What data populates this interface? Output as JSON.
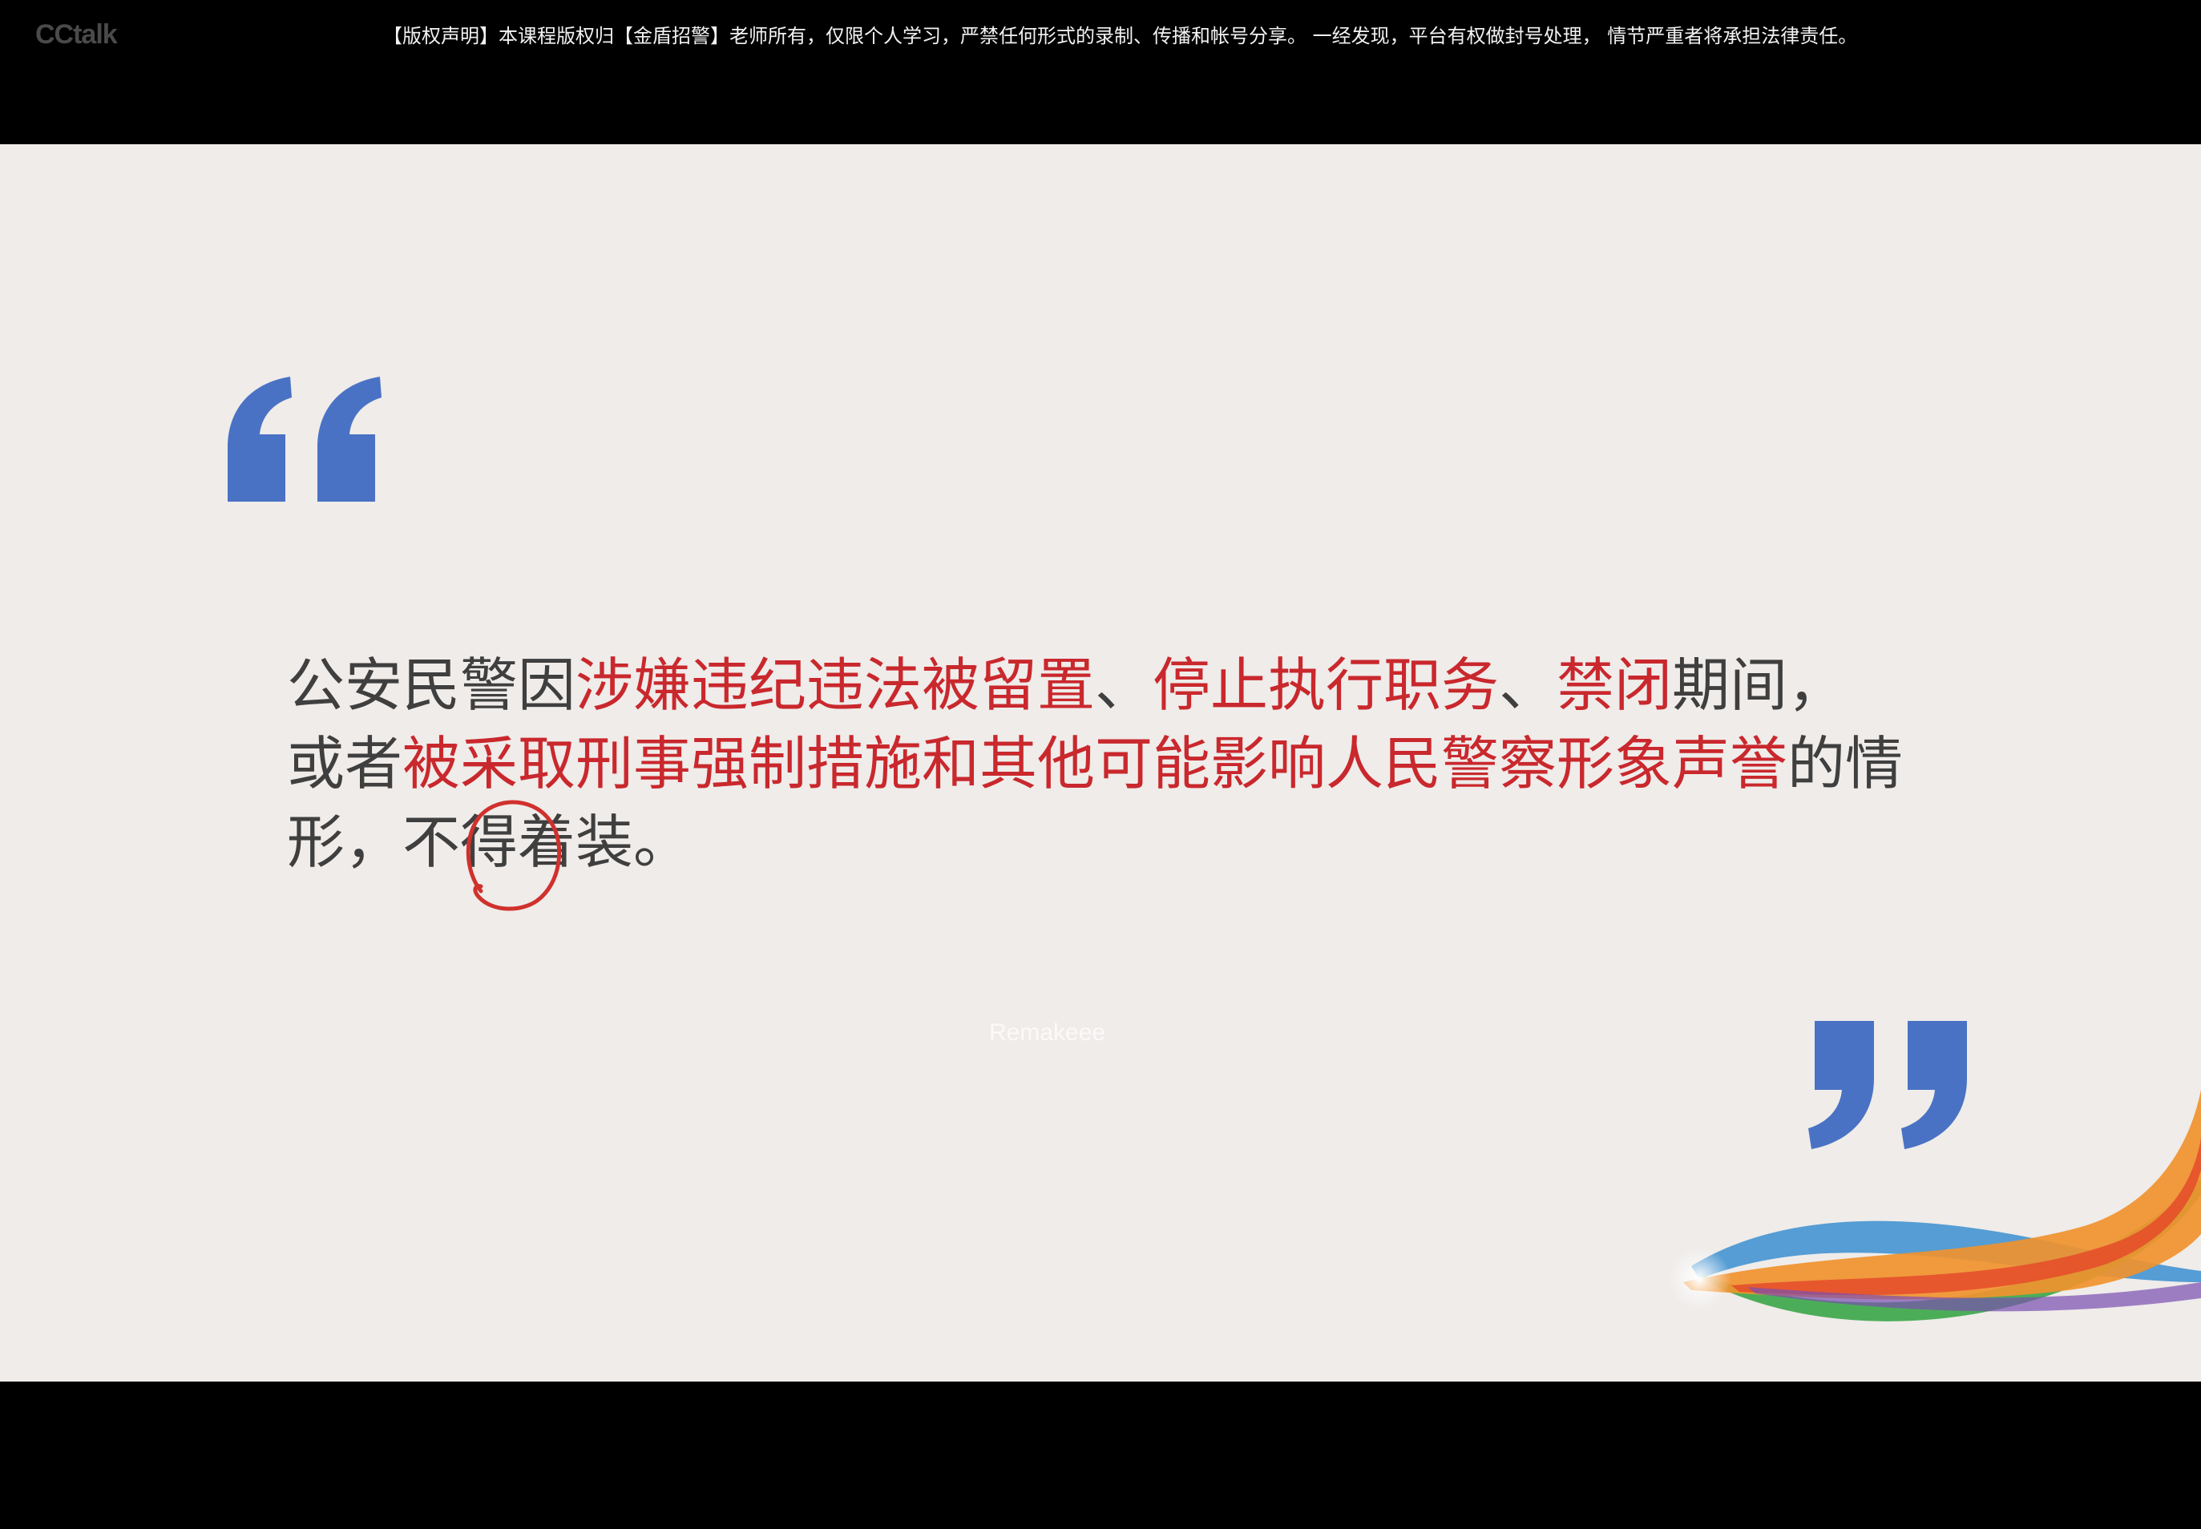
{
  "app": {
    "logo_text": "CCtalk"
  },
  "notice": {
    "text": "【版权声明】本课程版权归【金盾招警】老师所有，仅限个人学习，严禁任何形式的录制、传播和帐号分享。 一经发现，平台有权做封号处理， 情节严重者将承担法律责任。"
  },
  "slide": {
    "quote_segments": [
      {
        "text": "公安民警因",
        "highlight": false
      },
      {
        "text": "涉嫌违纪违法被留置",
        "highlight": true
      },
      {
        "text": "、",
        "highlight": false
      },
      {
        "text": "停止执行职务",
        "highlight": true
      },
      {
        "text": "、",
        "highlight": false
      },
      {
        "text": "禁闭",
        "highlight": true
      },
      {
        "text": "期间，",
        "highlight": false
      },
      {
        "text": "或者",
        "highlight": false
      },
      {
        "text": "被采取刑事强制措施和其他可能影响人民警察形象声誉",
        "highlight": true
      },
      {
        "text": "的情形，不得着装。",
        "highlight": false
      }
    ],
    "watermark": "Remakeee"
  },
  "colors": {
    "quote_mark": "#4a72c4",
    "highlight": "#c9282d",
    "body_text": "#3f3f3f",
    "slide_bg": "#efecea",
    "pen_annotation": "#d0312d"
  },
  "icons": {
    "open_quote": "open-quote-icon",
    "close_quote": "close-quote-icon",
    "ribbon": "ribbon-decoration"
  }
}
